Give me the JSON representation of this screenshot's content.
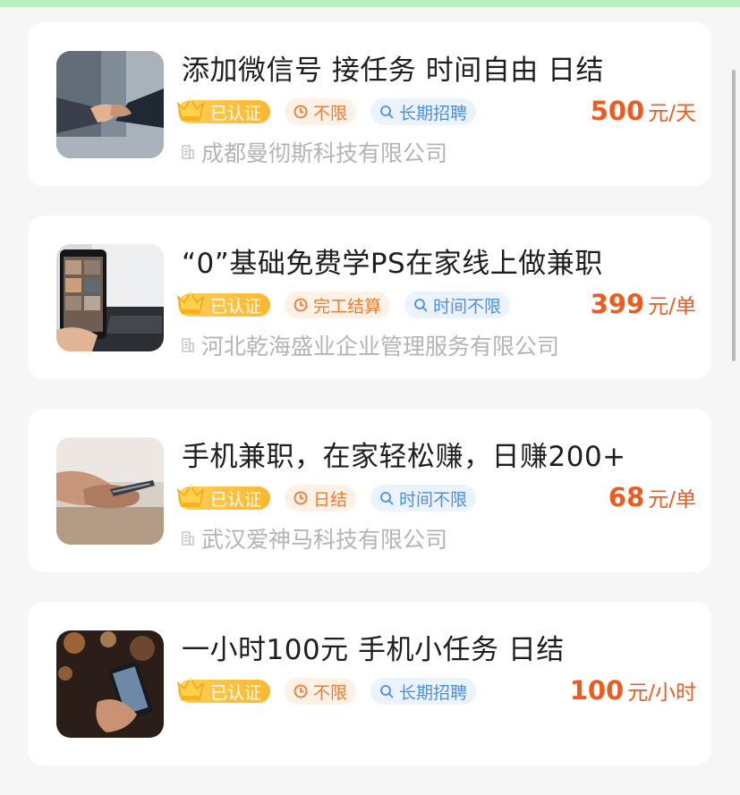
{
  "jobs": [
    {
      "thumbnail": "handshake-photo",
      "title": "添加微信号 接任务 时间自由 日结",
      "badge": "已认证",
      "time_tag": "不限",
      "recruit_tag": "长期招聘",
      "price": "500",
      "unit": "元/天",
      "company": "成都曼彻斯科技有限公司"
    },
    {
      "thumbnail": "phone-laptop-photo",
      "title": "“0”基础免费学PS在家线上做兼职",
      "badge": "已认证",
      "time_tag": "完工结算",
      "recruit_tag": "时间不限",
      "price": "399",
      "unit": "元/单",
      "company": "河北乾海盛业企业管理服务有限公司"
    },
    {
      "thumbnail": "hands-phone-photo",
      "title": "手机兼职，在家轻松赚，日赚200+",
      "badge": "已认证",
      "time_tag": "日结",
      "recruit_tag": "时间不限",
      "price": "68",
      "unit": "元/单",
      "company": "武汉爱神马科技有限公司"
    },
    {
      "thumbnail": "phone-night-photo",
      "title": "一小时100元 手机小任务 日结",
      "badge": "已认证",
      "time_tag": "不限",
      "recruit_tag": "长期招聘",
      "price": "100",
      "unit": "元/小时",
      "company": ""
    }
  ],
  "colors": {
    "top_accent": "#b6f0c2",
    "price": "#f05a1e",
    "badge": "#ffb72e",
    "time_tag_text": "#f07a2c",
    "recruit_tag_text": "#4a8ef2"
  },
  "icons": {
    "badge": "crown-icon",
    "time": "clock-icon",
    "recruit": "search-icon",
    "company": "building-icon"
  }
}
